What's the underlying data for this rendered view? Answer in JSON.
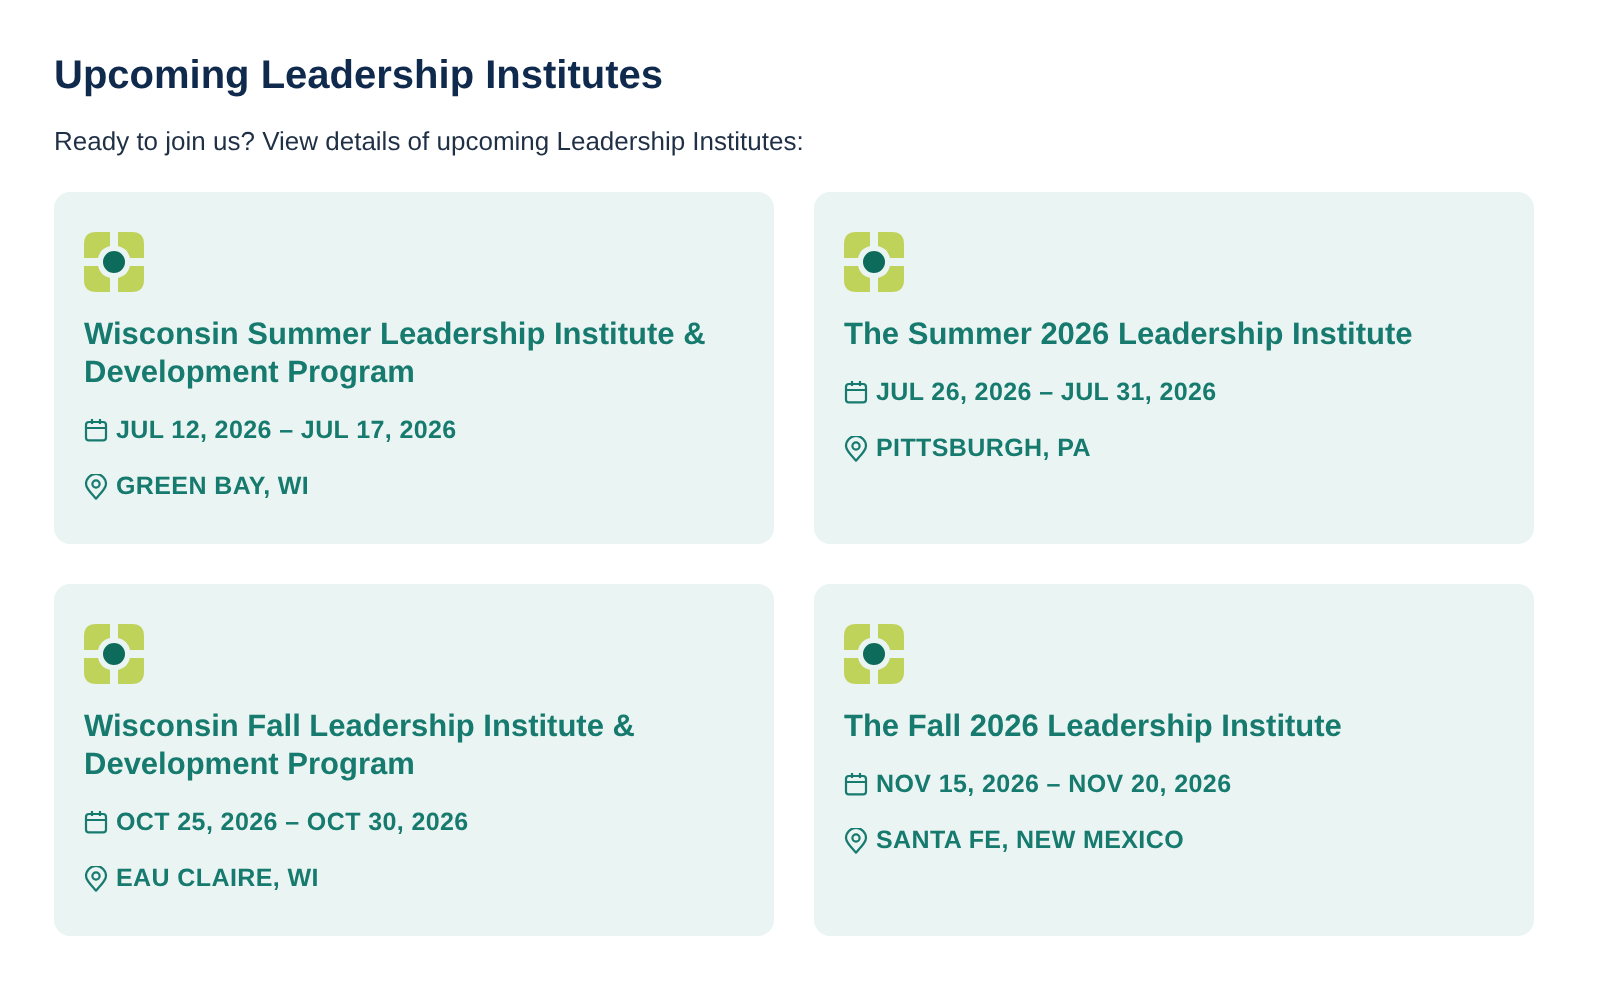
{
  "heading": "Upcoming Leadership Institutes",
  "intro": "Ready to join us? View details of upcoming Leadership Institutes:",
  "events": [
    {
      "title": "Wisconsin Summer Leadership Institute & Development Program",
      "dates": "JUL 12, 2026 – JUL 17, 2026",
      "location": "GREEN BAY, WI"
    },
    {
      "title": "The Summer 2026 Leadership Institute",
      "dates": "JUL 26, 2026 – JUL 31, 2026",
      "location": "PITTSBURGH, PA"
    },
    {
      "title": "Wisconsin Fall Leadership Institute & Development Program",
      "dates": "OCT 25, 2026 – OCT 30, 2026",
      "location": "EAU CLAIRE, WI"
    },
    {
      "title": "The Fall 2026 Leadership Institute",
      "dates": "NOV 15, 2026 – NOV 20, 2026",
      "location": "SANTA FE, NEW MEXICO"
    }
  ]
}
